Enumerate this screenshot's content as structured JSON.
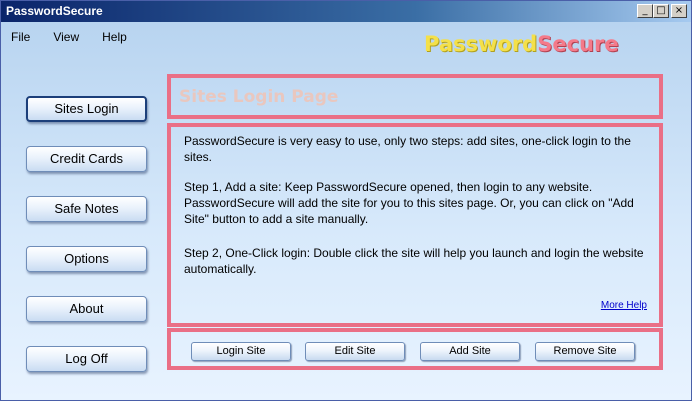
{
  "window": {
    "title": "PasswordSecure"
  },
  "titlebar_buttons": {
    "minimize": "_",
    "maximize": "□",
    "close": "×"
  },
  "menu": [
    "File",
    "View",
    "Help"
  ],
  "logo": {
    "part1": "Password",
    "part2": "Secure",
    "color1": "#f4e04a",
    "color2": "#f47a8a"
  },
  "nav": [
    {
      "label": "Sites Login",
      "active": true
    },
    {
      "label": "Credit Cards"
    },
    {
      "label": "Safe Notes"
    },
    {
      "label": "Options"
    },
    {
      "label": "About"
    },
    {
      "label": "Log Off"
    }
  ],
  "main": {
    "title": "Sites Login Page",
    "intro": "PasswordSecure is very easy to use, only two steps: add sites, one-click login to the sites.",
    "step1": "Step 1, Add a site: Keep PasswordSecure opened, then login to any website. PasswordSecure will add the site for you to this sites page.  Or, you can click on \"Add Site\" button to add a site manually.",
    "step2": "Step 2, One-Click login: Double click the site will help you launch and login the website automatically.",
    "more_help": "More Help"
  },
  "actions": {
    "login_site": "Login Site",
    "edit_site": "Edit Site",
    "add_site": "Add Site",
    "remove_site": "Remove Site"
  },
  "colors": {
    "panel_border": "#ea6f86",
    "title_text": "#e9c7bf",
    "link": "#0000cc"
  }
}
